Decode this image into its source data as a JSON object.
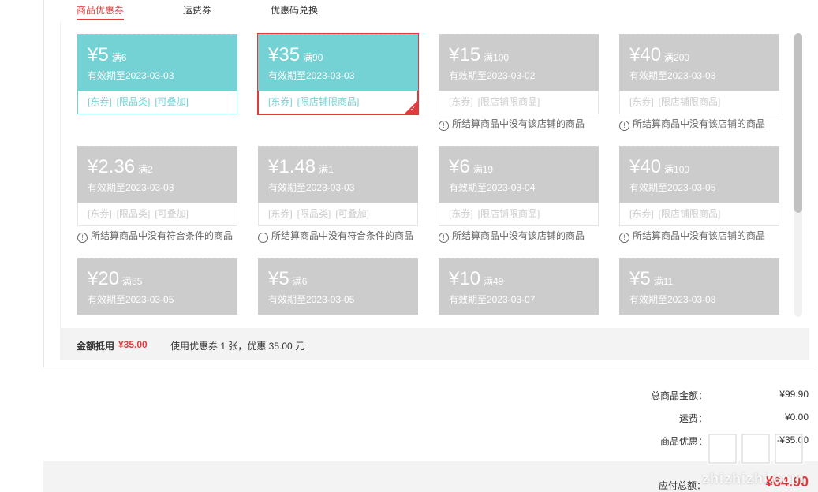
{
  "tabs": [
    {
      "label": "商品优惠券",
      "active": true
    },
    {
      "label": "运费券",
      "active": false
    },
    {
      "label": "优惠码兑换",
      "active": false
    }
  ],
  "coupons": [
    {
      "amount": "¥5",
      "condition": "满6",
      "expire": "有效期至2023-03-03",
      "tags": [
        "[东券]",
        "[限品类]",
        "[可叠加]"
      ],
      "usable": true,
      "selected": false,
      "warning": ""
    },
    {
      "amount": "¥35",
      "condition": "满90",
      "expire": "有效期至2023-03-03",
      "tags": [
        "[东券]",
        "[限店铺限商品]"
      ],
      "usable": true,
      "selected": true,
      "warning": ""
    },
    {
      "amount": "¥15",
      "condition": "满100",
      "expire": "有效期至2023-03-02",
      "tags": [
        "[东券]",
        "[限店铺限商品]"
      ],
      "usable": false,
      "selected": false,
      "warning": "所结算商品中没有该店铺的商品"
    },
    {
      "amount": "¥40",
      "condition": "满200",
      "expire": "有效期至2023-03-03",
      "tags": [
        "[东券]",
        "[限店铺限商品]"
      ],
      "usable": false,
      "selected": false,
      "warning": "所结算商品中没有该店铺的商品"
    },
    {
      "amount": "¥2.36",
      "condition": "满2",
      "expire": "有效期至2023-03-03",
      "tags": [
        "[东券]",
        "[限品类]",
        "[可叠加]"
      ],
      "usable": false,
      "selected": false,
      "warning": "所结算商品中没有符合条件的商品"
    },
    {
      "amount": "¥1.48",
      "condition": "满1",
      "expire": "有效期至2023-03-03",
      "tags": [
        "[东券]",
        "[限品类]",
        "[可叠加]"
      ],
      "usable": false,
      "selected": false,
      "warning": "所结算商品中没有符合条件的商品"
    },
    {
      "amount": "¥6",
      "condition": "满19",
      "expire": "有效期至2023-03-04",
      "tags": [
        "[东券]",
        "[限店铺限商品]"
      ],
      "usable": false,
      "selected": false,
      "warning": "所结算商品中没有该店铺的商品"
    },
    {
      "amount": "¥40",
      "condition": "满100",
      "expire": "有效期至2023-03-05",
      "tags": [
        "[东券]",
        "[限店铺限商品]"
      ],
      "usable": false,
      "selected": false,
      "warning": "所结算商品中没有该店铺的商品"
    },
    {
      "amount": "¥20",
      "condition": "满55",
      "expire": "有效期至2023-03-05",
      "tags": [],
      "usable": false,
      "selected": false,
      "warning": ""
    },
    {
      "amount": "¥5",
      "condition": "满6",
      "expire": "有效期至2023-03-05",
      "tags": [],
      "usable": false,
      "selected": false,
      "warning": ""
    },
    {
      "amount": "¥10",
      "condition": "满49",
      "expire": "有效期至2023-03-07",
      "tags": [],
      "usable": false,
      "selected": false,
      "warning": ""
    },
    {
      "amount": "¥5",
      "condition": "满11",
      "expire": "有效期至2023-03-08",
      "tags": [],
      "usable": false,
      "selected": false,
      "warning": ""
    }
  ],
  "summary": {
    "label": "金额抵用",
    "amount": "¥35.00",
    "desc": "使用优惠券 1 张，优惠 35.00 元"
  },
  "totals": {
    "goods_label": "总商品金额：",
    "goods_value": "¥99.90",
    "shipping_label": "运费：",
    "shipping_value": "¥0.00",
    "discount_label": "商品优惠：",
    "discount_value": "-¥35.00",
    "pay_label": "应付总额：",
    "pay_value": "¥64.90"
  },
  "watermark": {
    "text": "zhizhizhi.com"
  },
  "colors": {
    "accent": "#e4393c",
    "usable": "#74d2d4",
    "disabled": "#cccccc"
  }
}
